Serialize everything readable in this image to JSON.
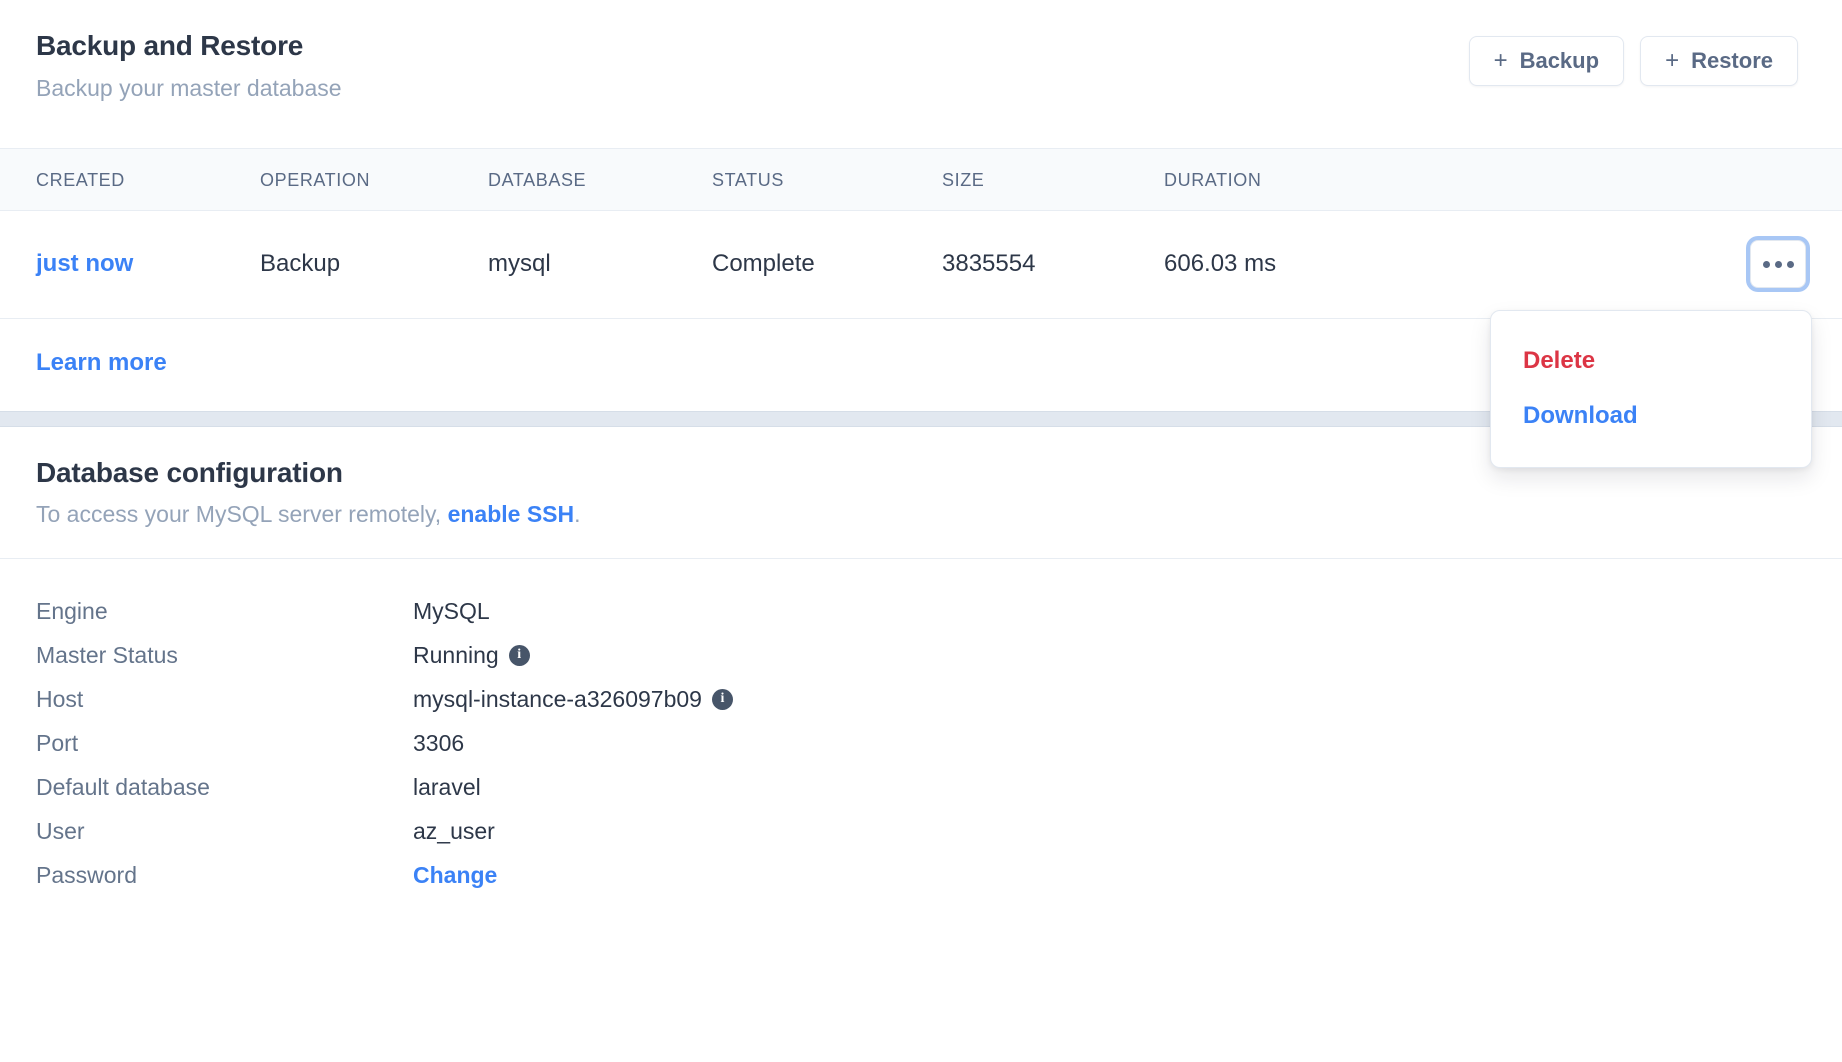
{
  "backup_card": {
    "title": "Backup and Restore",
    "subtitle": "Backup your master database",
    "actions": {
      "plus": "+",
      "backup_label": "Backup",
      "restore_label": "Restore"
    },
    "table": {
      "columns": [
        "CREATED",
        "OPERATION",
        "DATABASE",
        "STATUS",
        "SIZE",
        "DURATION"
      ],
      "rows": [
        {
          "created": "just now",
          "operation": "Backup",
          "database": "mysql",
          "status": "Complete",
          "size": "3835554",
          "duration": "606.03 ms"
        }
      ]
    },
    "footer_link": "Learn more"
  },
  "row_menu": {
    "items": [
      {
        "label": "Delete",
        "color": "#dc3545"
      },
      {
        "label": "Download",
        "color": "#3b82f6"
      }
    ]
  },
  "config_card": {
    "title": "Database configuration",
    "subtitle_prefix": "To access your MySQL server remotely, ",
    "subtitle_link": "enable SSH",
    "subtitle_suffix": ".",
    "rows": [
      {
        "key": "Engine",
        "value": "MySQL",
        "info": false
      },
      {
        "key": "Master Status",
        "value": "Running",
        "info": true
      },
      {
        "key": "Host",
        "value": "mysql-instance-a326097b09",
        "info": true
      },
      {
        "key": "Port",
        "value": "3306",
        "info": false
      },
      {
        "key": "Default database",
        "value": "laravel",
        "info": false
      },
      {
        "key": "User",
        "value": "az_user",
        "info": false
      },
      {
        "key": "Password",
        "value": "Change",
        "info": false,
        "link": true
      }
    ],
    "info_glyph": "i"
  },
  "colors": {
    "link_blue": "#3b82f6",
    "danger_red": "#dc3545",
    "heading": "#2d3748",
    "muted": "#94a3b8",
    "band": "#e2e8f0",
    "focus_ring": "#a8c7f5"
  }
}
